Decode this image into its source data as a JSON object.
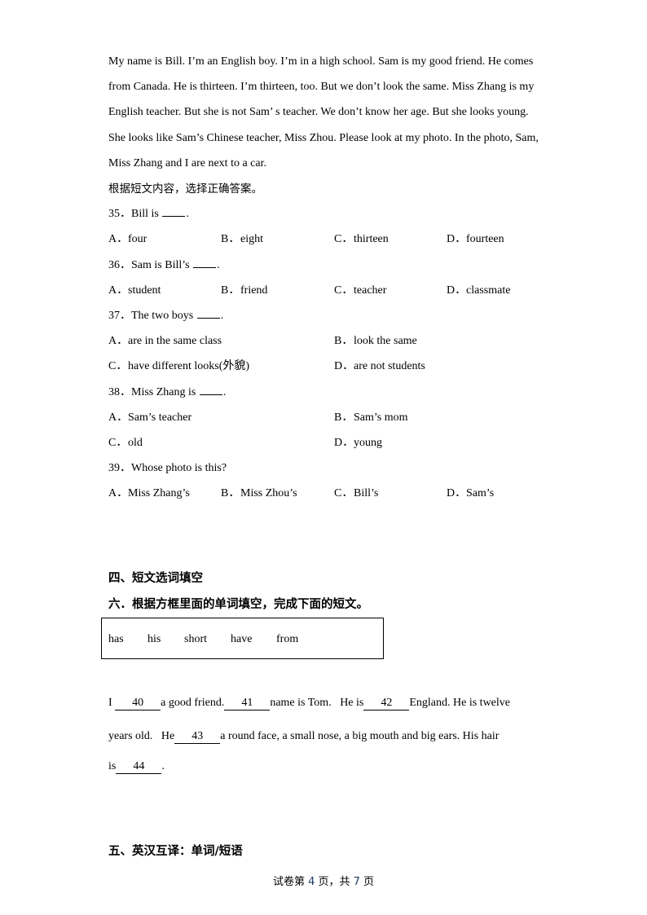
{
  "passage": {
    "lines": [
      "My name is Bill. I’m an English boy. I’m in a high school. Sam is my good friend. He comes",
      "from Canada. He is thirteen. I’m thirteen, too. But we don’t look the same. Miss Zhang is my",
      "English teacher. But she is not Sam’ s teacher. We don’t know her age. But she looks young.",
      "She looks like Sam’s Chinese teacher, Miss Zhou. Please look at my photo. In the photo, Sam,",
      "Miss Zhang and I are next to a car."
    ],
    "instruction": "根据短文内容，选择正确答案。"
  },
  "questions": [
    {
      "number": "35．",
      "stem_before": "Bill is ",
      "stem_after": ".",
      "has_blank": true,
      "options": [
        {
          "letter": "A．",
          "text": "four"
        },
        {
          "letter": "B．",
          "text": "eight"
        },
        {
          "letter": "C．",
          "text": "thirteen"
        },
        {
          "letter": "D．",
          "text": "fourteen"
        }
      ]
    },
    {
      "number": "36．",
      "stem_before": "Sam is Bill’s ",
      "stem_after": ".",
      "has_blank": true,
      "options": [
        {
          "letter": "A．",
          "text": "student"
        },
        {
          "letter": "B．",
          "text": "friend"
        },
        {
          "letter": "C．",
          "text": "teacher"
        },
        {
          "letter": "D．",
          "text": "classmate"
        }
      ]
    },
    {
      "number": "37．",
      "stem_before": "The two boys ",
      "stem_after": ".",
      "has_blank": true,
      "options": [
        {
          "letter": "A．",
          "text": "are in the same class"
        },
        {
          "letter": "B．",
          "text": "look the same"
        },
        {
          "letter": "C．",
          "text": "have different looks(外貌)"
        },
        {
          "letter": "D．",
          "text": "are not students"
        }
      ]
    },
    {
      "number": "38．",
      "stem_before": "Miss Zhang is ",
      "stem_after": ".",
      "has_blank": true,
      "options": [
        {
          "letter": "A．",
          "text": "Sam’s teacher"
        },
        {
          "letter": "B．",
          "text": "Sam’s mom"
        },
        {
          "letter": "C．",
          "text": "old"
        },
        {
          "letter": "D．",
          "text": "young"
        }
      ]
    },
    {
      "number": "39．",
      "stem_before": "Whose photo is this?",
      "stem_after": "",
      "has_blank": false,
      "options": [
        {
          "letter": "A．",
          "text": "Miss Zhang’s"
        },
        {
          "letter": "B．",
          "text": "Miss Zhou’s"
        },
        {
          "letter": "C．",
          "text": "Bill’s"
        },
        {
          "letter": "D．",
          "text": "Sam’s"
        }
      ]
    }
  ],
  "section4": {
    "heading": "四、短文选词填空",
    "subheading": "六．根据方框里面的单词填空，完成下面的短文。",
    "word_bank": [
      "has",
      "his",
      "short",
      "have",
      "from"
    ],
    "cloze": {
      "line1": {
        "t1": "I ",
        "b1": "40",
        "t2": "a good friend.",
        "b2": "41",
        "t3": "name is Tom.   He is",
        "b3": "42",
        "t4": "England. He is twelve"
      },
      "line2": {
        "t1": "years old.   He",
        "b1": "43",
        "t2": "a round face, a small nose, a big mouth and big ears. His hair"
      },
      "line3": {
        "t1": "is",
        "b1": "44",
        "t2": "."
      }
    }
  },
  "section5": {
    "heading": "五、英汉互译：单词/短语"
  },
  "footer": {
    "prefix": "试卷第 ",
    "page": "4",
    "middle": " 页，共 ",
    "total": "7",
    "suffix": " 页"
  }
}
